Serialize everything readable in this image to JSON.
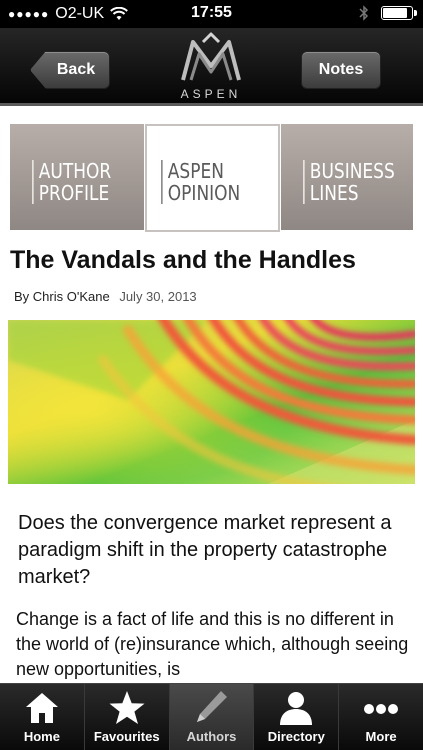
{
  "status_bar": {
    "signal": "●●●●●",
    "carrier": "O2-UK",
    "time": "17:55",
    "battery_level": 0.9
  },
  "header": {
    "back_label": "Back",
    "notes_label": "Notes",
    "logo_text": "ASPEN"
  },
  "tabs": [
    {
      "label": "AUTHOR\nPROFILE",
      "active": false
    },
    {
      "label": "ASPEN\nOPINION",
      "active": true
    },
    {
      "label": "BUSINESS\nLINES",
      "active": false
    }
  ],
  "article": {
    "title": "The Vandals and the Handles",
    "byline_prefix": "By",
    "author": "Chris O'Kane",
    "date": "July 30, 2013",
    "lede": "Does the convergence market represent a paradigm shift in the property catastrophe market?",
    "body": "Change is a fact of life and this is no different in the world of (re)insurance which, although seeing new opportunities, is"
  },
  "tabbar": [
    {
      "label": "Home",
      "icon": "home-icon",
      "selected": false
    },
    {
      "label": "Favourites",
      "icon": "star-icon",
      "selected": false
    },
    {
      "label": "Authors",
      "icon": "pen-icon",
      "selected": true
    },
    {
      "label": "Directory",
      "icon": "person-icon",
      "selected": false
    },
    {
      "label": "More",
      "icon": "more-icon",
      "selected": false
    }
  ]
}
